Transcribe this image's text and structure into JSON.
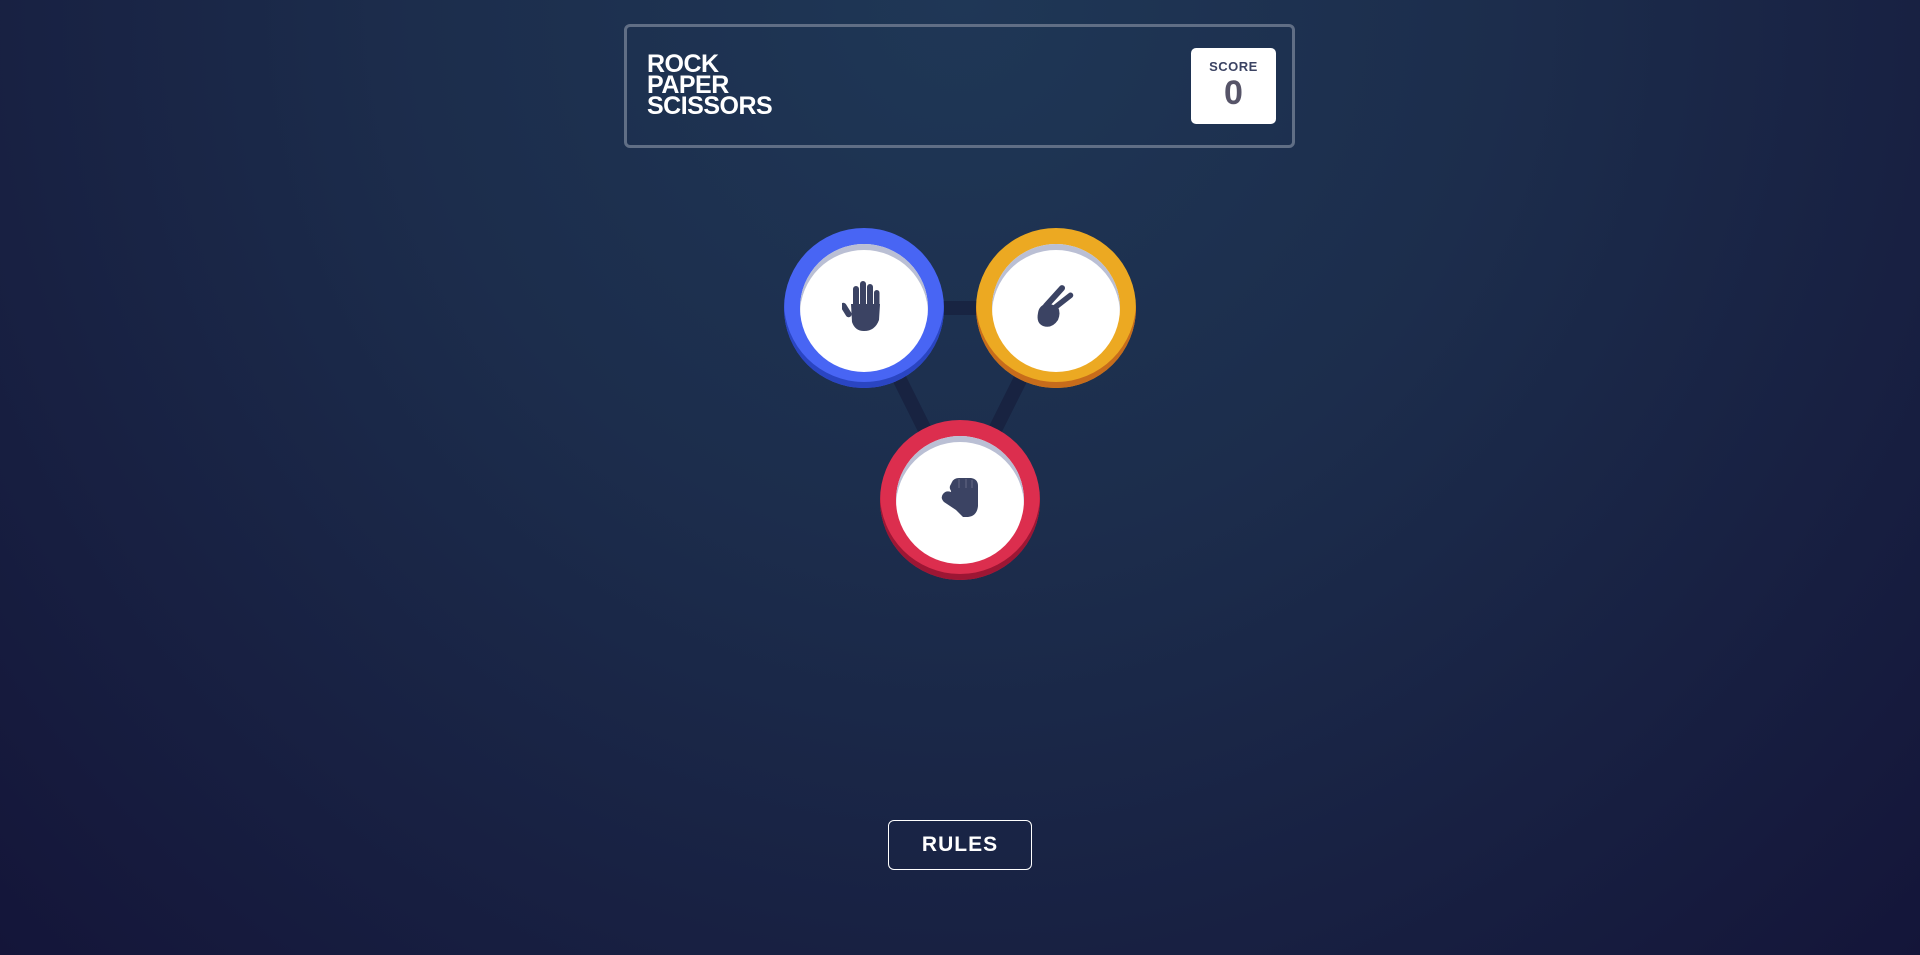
{
  "header": {
    "title_lines": [
      "ROCK",
      "PAPER",
      "SCISSORS"
    ],
    "score_label": "SCORE",
    "score_value": "0"
  },
  "tokens": [
    {
      "name": "paper",
      "icon": "hand-paper-icon",
      "ring_color": "#4865f4"
    },
    {
      "name": "scissors",
      "icon": "hand-scissors-icon",
      "ring_color": "#eca922"
    },
    {
      "name": "rock",
      "icon": "hand-rock-icon",
      "ring_color": "#dc2e4e"
    }
  ],
  "footer": {
    "rules_label": "RULES"
  },
  "colors": {
    "background_top": "#1f3756",
    "background_bottom": "#141539",
    "header_border": "#606e85",
    "icon": "#3b4363"
  }
}
